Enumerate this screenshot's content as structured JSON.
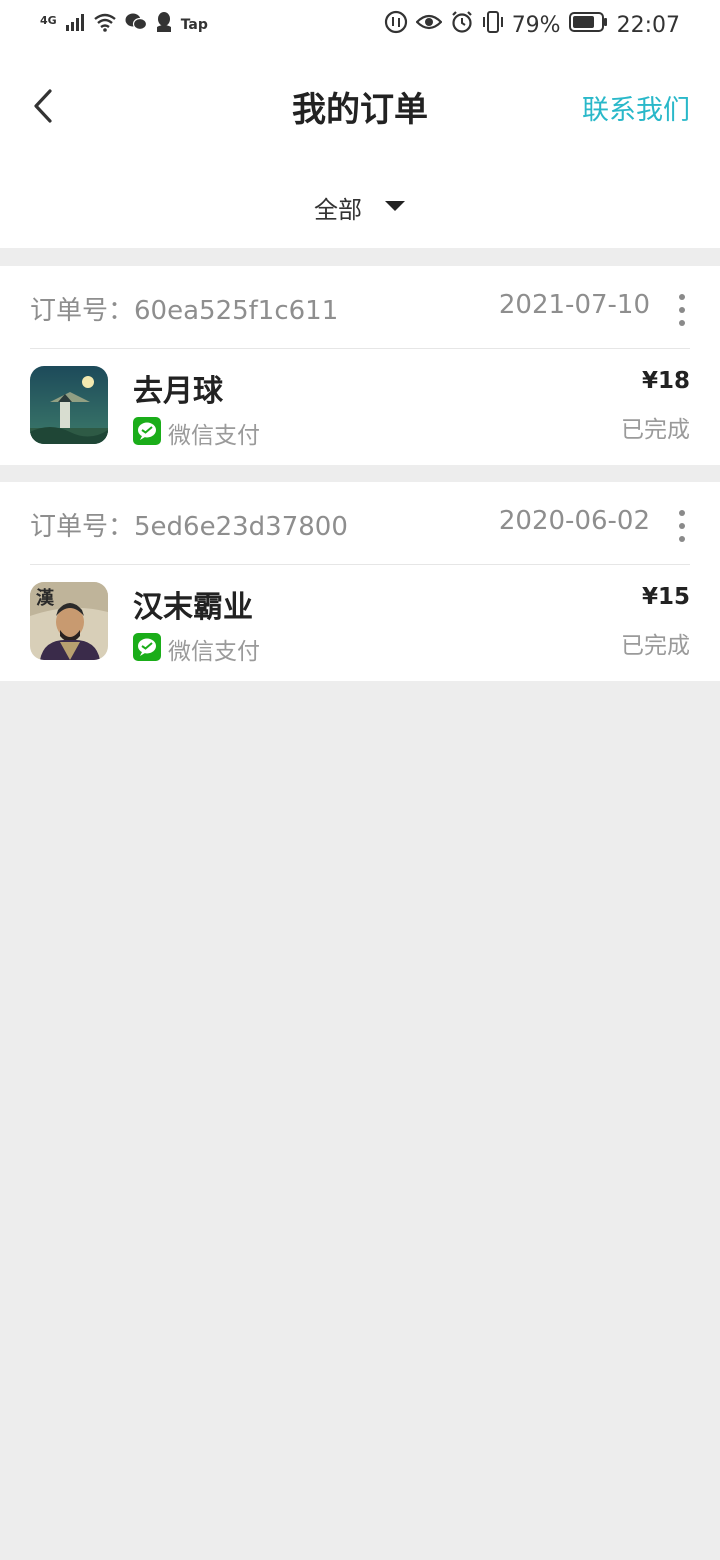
{
  "status_bar": {
    "network": "4G",
    "tap_label": "Tap",
    "battery": "79%",
    "time": "22:07"
  },
  "header": {
    "title": "我的订单",
    "contact_label": "联系我们",
    "filter_label": "全部"
  },
  "colors": {
    "accent": "#29b8c9",
    "wechat_green": "#1aad19",
    "background": "#ededed"
  },
  "orders": [
    {
      "order_no_label": "订单号：",
      "order_no": "60ea525f1c611",
      "date": "2021-07-10",
      "game_name": "去月球",
      "payment": "微信支付",
      "price": "¥18",
      "status": "已完成"
    },
    {
      "order_no_label": "订单号：",
      "order_no": "5ed6e23d37800",
      "date": "2020-06-02",
      "game_name": "汉末霸业",
      "payment": "微信支付",
      "price": "¥15",
      "status": "已完成",
      "icon_text": "漢"
    }
  ]
}
